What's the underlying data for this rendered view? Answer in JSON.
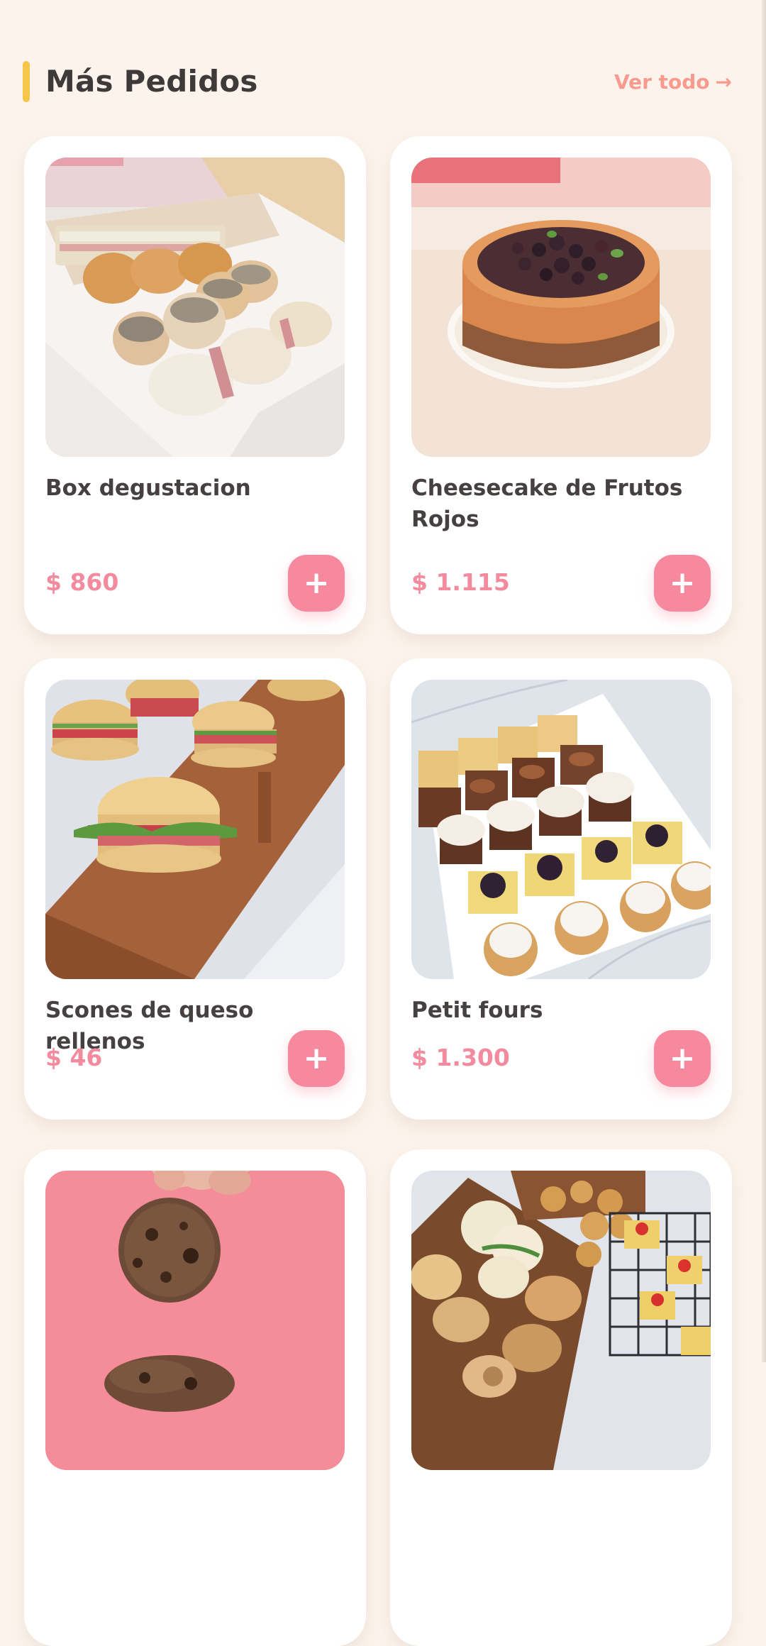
{
  "section": {
    "title": "Más Pedidos",
    "see_all": "Ver todo",
    "see_all_arrow": "→"
  },
  "colors": {
    "background": "#fcf4ec",
    "accent_bar": "#f6c64a",
    "price": "#f38b9f",
    "add_button": "#f7899e",
    "see_all": "#f79b8e"
  },
  "products": [
    {
      "name": "Box degustacion",
      "price": "$ 860",
      "add_label": "+"
    },
    {
      "name": "Cheesecake de Frutos Rojos",
      "price": "$ 1.115",
      "add_label": "+"
    },
    {
      "name": "Scones de queso rellenos",
      "price": "$ 46",
      "add_label": "+"
    },
    {
      "name": "Petit fours",
      "price": "$ 1.300",
      "add_label": "+"
    },
    {
      "name": "",
      "price": "",
      "add_label": "+"
    },
    {
      "name": "",
      "price": "",
      "add_label": "+"
    }
  ]
}
